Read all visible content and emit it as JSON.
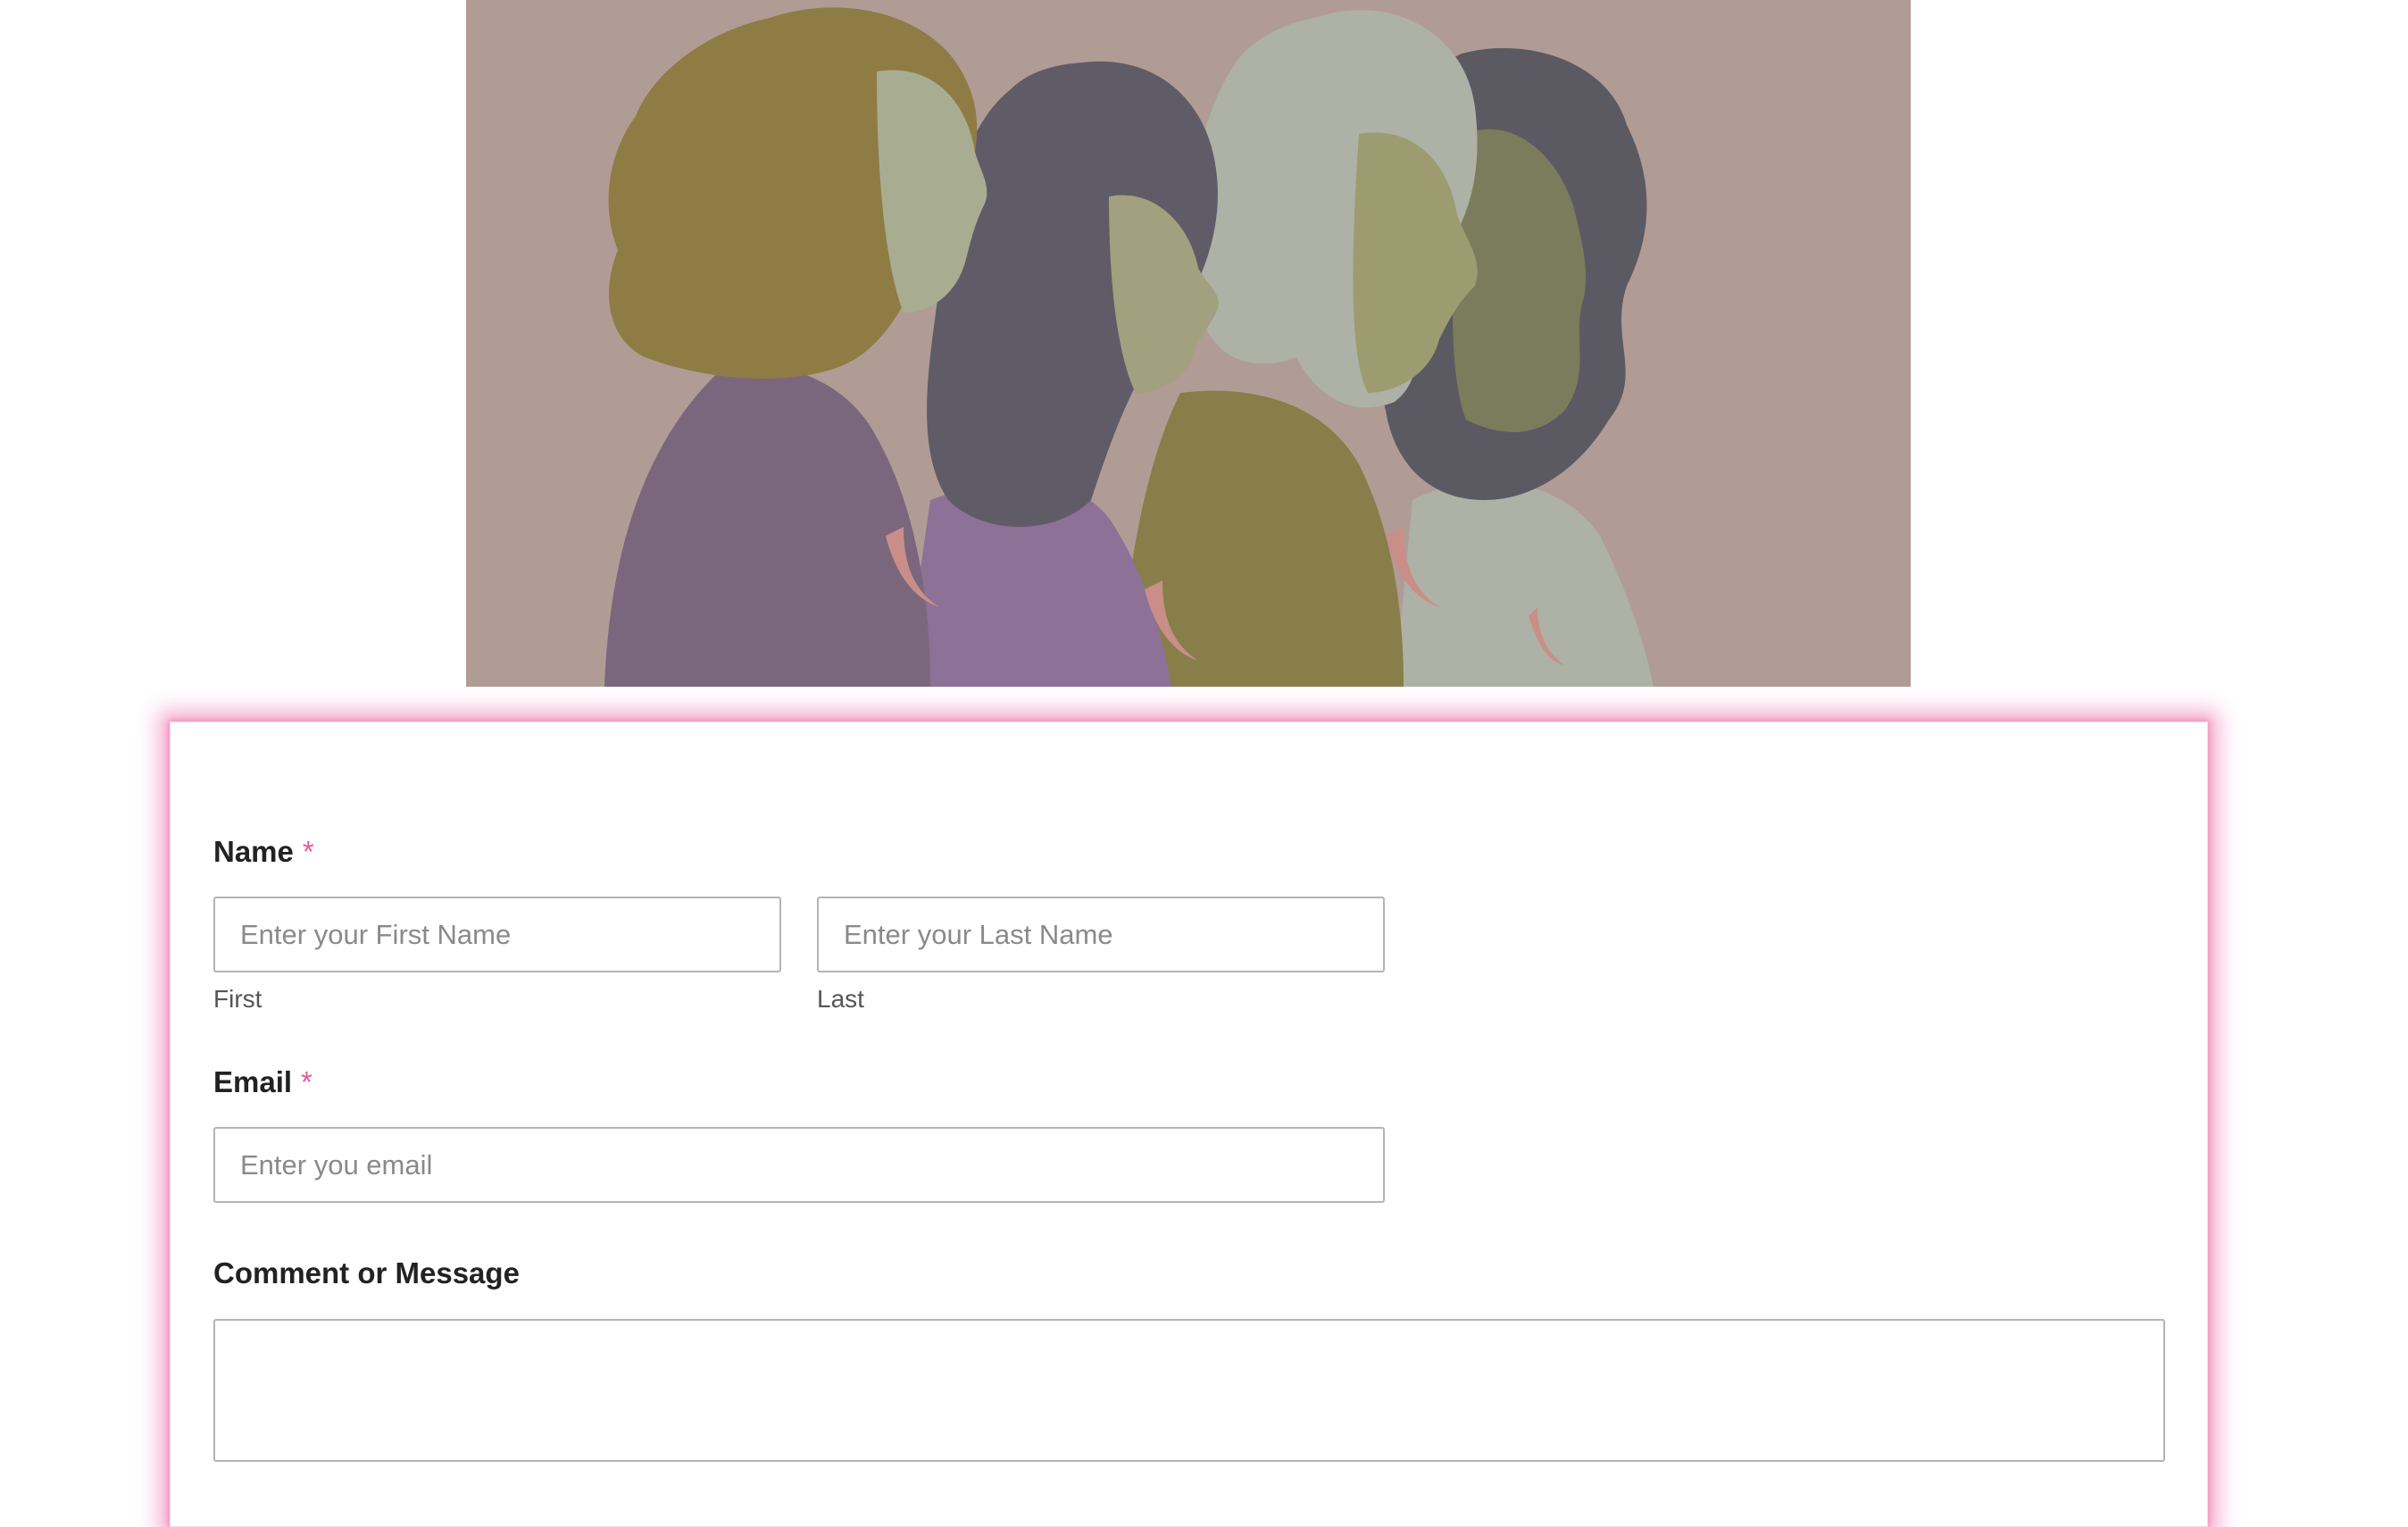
{
  "colors": {
    "accent": "#e05b9b",
    "card_glow": "#ec4899",
    "hero_background": "#b09c95",
    "input_border": "#b4b4b4"
  },
  "hero_image": {
    "semantic": "illustration of four women in profile"
  },
  "form": {
    "name": {
      "label": "Name",
      "required_mark": "*",
      "first": {
        "placeholder": "Enter your First Name",
        "sublabel": "First",
        "value": ""
      },
      "last": {
        "placeholder": "Enter your Last Name",
        "sublabel": "Last",
        "value": ""
      }
    },
    "email": {
      "label": "Email",
      "required_mark": "*",
      "placeholder": "Enter you email",
      "value": ""
    },
    "message": {
      "label": "Comment or Message",
      "value": ""
    }
  }
}
